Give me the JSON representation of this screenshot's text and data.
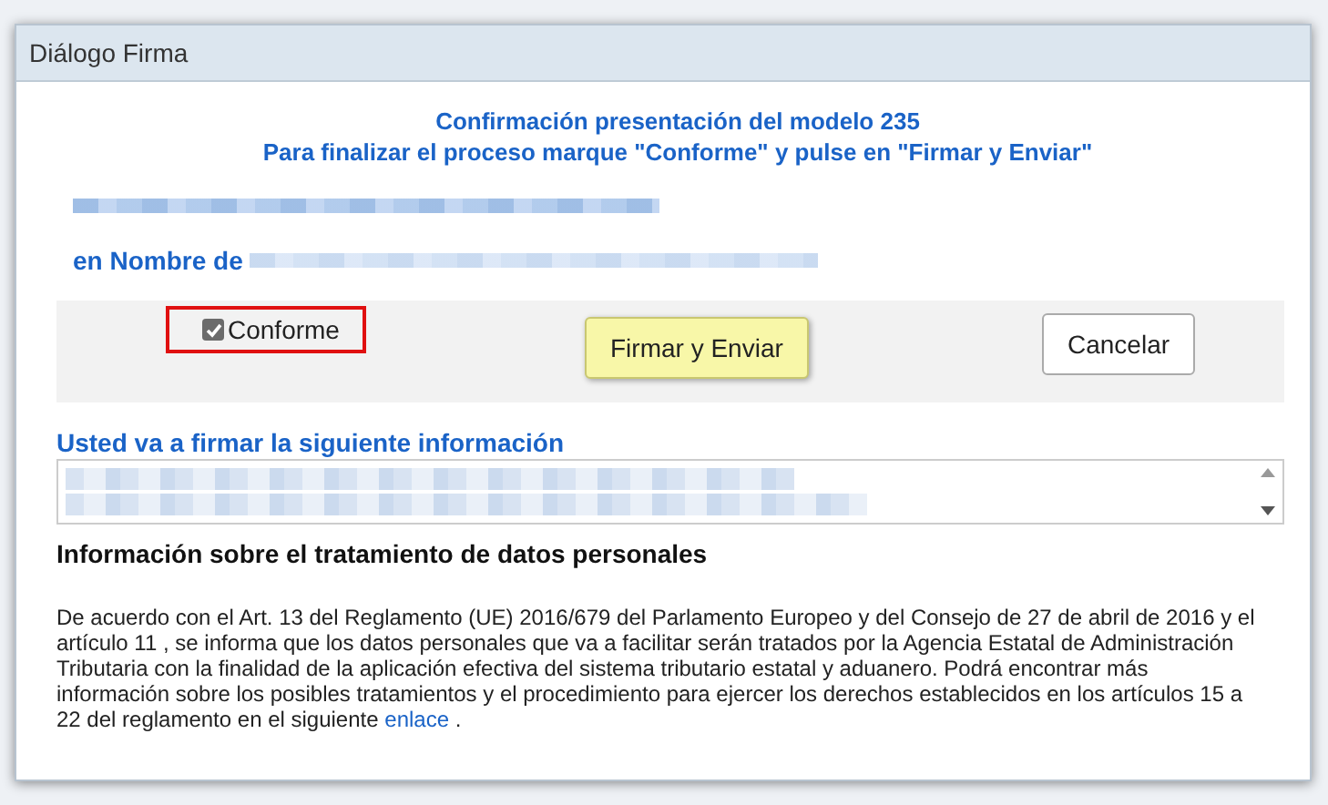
{
  "window": {
    "title": "Diálogo Firma"
  },
  "heading": {
    "line_1": "Confirmación presentación del modelo 235",
    "line_2": "Para finalizar el proceso marque \"Conforme\" y pulse en \"Firmar y Enviar\""
  },
  "on_behalf_label": "en Nombre de",
  "agree_checkbox": {
    "label": "Conforme",
    "checked": true
  },
  "buttons": [
    {
      "label": "Firmar y Enviar",
      "kind": "primary"
    },
    {
      "label": "Cancelar",
      "kind": "secondary"
    }
  ],
  "sign_info": {
    "label": "Usted va a firmar la siguiente información"
  },
  "privacy": {
    "title": "Información sobre el tratamiento de datos personales",
    "text": "De acuerdo con el Art. 13 del Reglamento (UE) 2016/679 del Parlamento Europeo y del Consejo de 27 de abril de 2016 y el artículo 11 , se informa que los datos personales que va a facilitar serán tratados por la Agencia Estatal de Administración Tributaria con la finalidad de la aplicación efectiva del sistema tributario estatal y aduanero. Podrá encontrar más información sobre los posibles tratamientos y el procedimiento para ejercer los derechos establecidos en los artículos 15 a 22 del reglamento en el siguiente",
    "link": "enlace",
    "text_end": " ."
  }
}
